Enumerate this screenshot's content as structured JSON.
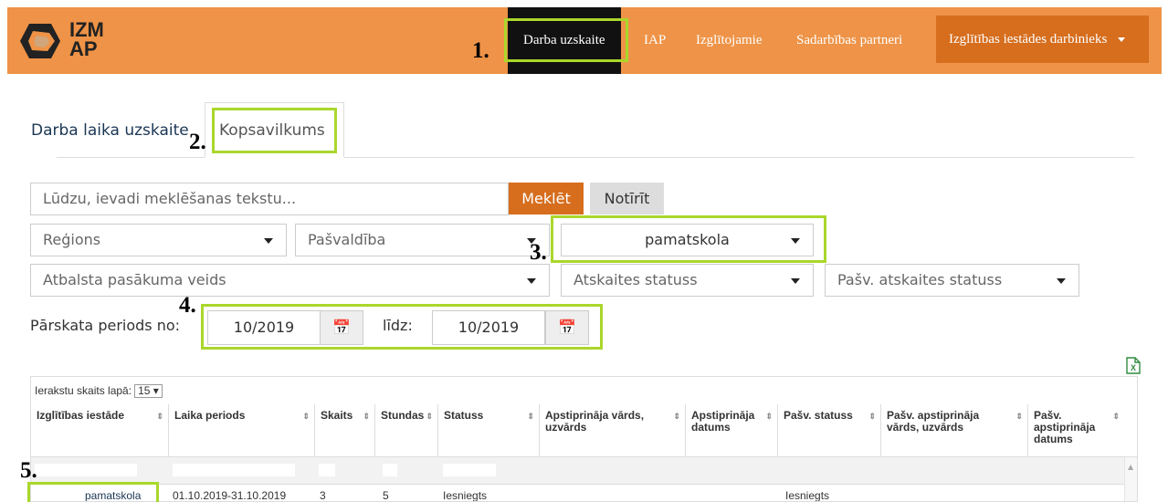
{
  "nav": {
    "logo_line1": "IZM",
    "logo_line2": "AP",
    "items": [
      "Darba uzskaite",
      "IAP",
      "Izglītojamie",
      "Sadarbības partneri"
    ],
    "user_menu": "Izglītības iestādes darbinieks"
  },
  "tabs": [
    "Darba laika uzskaite",
    "Kopsavilkums"
  ],
  "filters": {
    "search_placeholder": "Lūdzu, ievadi meklēšanas tekstu...",
    "search_button": "Meklēt",
    "clear_button": "Notīrīt",
    "region": "Reģions",
    "municipality": "Pašvaldība",
    "school_type": "pamatskola",
    "activity_type": "Atbalsta pasākuma veids",
    "report_status": "Atskaites statuss",
    "municipal_status": "Pašv. atskaites statuss",
    "period_from_label": "Pārskata periods no:",
    "period_from": "10/2019",
    "period_to_label": "līdz:",
    "period_to": "10/2019"
  },
  "steps": [
    "1.",
    "2.",
    "3.",
    "4.",
    "5."
  ],
  "table": {
    "per_page_label": "Ierakstu skaits lapā:",
    "per_page": "15",
    "headers": [
      "Izglītības iestāde",
      "Laika periods",
      "Skaits",
      "Stundas",
      "Statuss",
      "Apstiprināja vārds, uzvārds",
      "Apstiprināja datums",
      "Pašv. statuss",
      "Pašv. apstiprināja vārds, uzvārds",
      "Pašv. apstiprināja datums"
    ],
    "row": {
      "school": "pamatskola",
      "period": "01.10.2019-31.10.2019",
      "count": "3",
      "hours": "5",
      "status": "Iesniegts",
      "municipal_status": "Iesniegts"
    }
  },
  "colors": {
    "nav": "#ee9347",
    "accent": "#d66e1e",
    "highlight": "#aad72b"
  }
}
